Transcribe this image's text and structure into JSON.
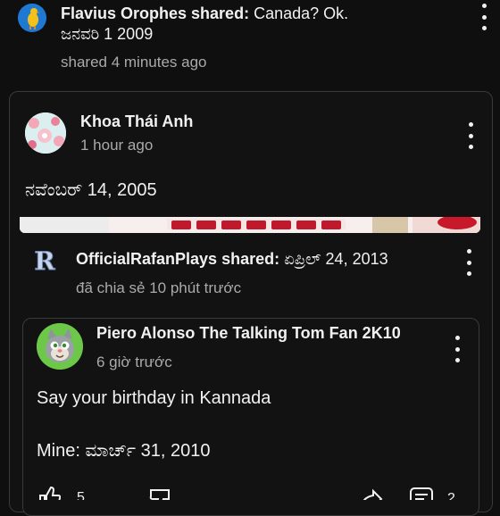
{
  "top_post": {
    "author": "Flavius Orophes shared:",
    "title": "Canada? Ok.",
    "date_text": "ಜನವರಿ 1 2009",
    "time": "shared 4 minutes ago"
  },
  "card1": {
    "author": "Khoa Thái Anh",
    "time": "1 hour ago",
    "body": "ನವೆಂಬರ್ 14, 2005"
  },
  "shared_post": {
    "author": "OfficialRafanPlays shared:",
    "text": "ಏಪ್ರಿಲ್ 24, 2013",
    "time": "đã chia sẻ 10 phút trước"
  },
  "card2": {
    "author": "Piero Alonso The Talking Tom Fan 2K10",
    "time": "6 giờ trước",
    "body_line1": "Say your birthday in Kannada",
    "body_line2": "Mine: ಮಾರ್ಚ್ 31, 2010"
  },
  "actions": {
    "like_count": "5",
    "comment_count": "2"
  },
  "colors": {
    "background": "#0f0f0f",
    "card_border": "#3a3a3a",
    "meta_text": "#aaaaaa"
  }
}
